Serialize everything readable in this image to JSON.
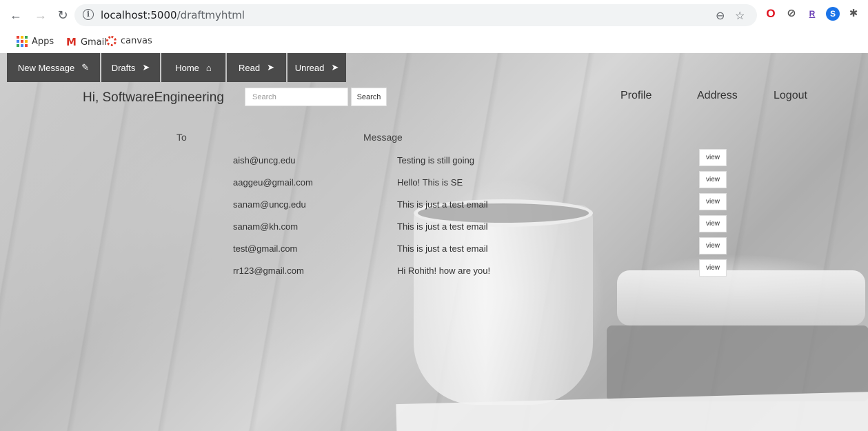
{
  "browser": {
    "url_host": "localhost:5000",
    "url_path": "/draftmyhtml",
    "bookmarks": [
      {
        "label": "Apps"
      },
      {
        "label": "Gmail"
      },
      {
        "label": "canvas"
      }
    ]
  },
  "nav": [
    {
      "label": "New Message",
      "icon": "pencil-icon"
    },
    {
      "label": "Drafts",
      "icon": "send-icon"
    },
    {
      "label": "Home",
      "icon": "home-icon"
    },
    {
      "label": "Read",
      "icon": "send-icon"
    },
    {
      "label": "Unread",
      "icon": "send-icon"
    }
  ],
  "header": {
    "greeting": "Hi, SoftwareEngineering",
    "search_placeholder": "Search",
    "search_button": "Search",
    "links": [
      "Profile",
      "Address",
      "Logout"
    ]
  },
  "table": {
    "columns": [
      "To",
      "Message"
    ],
    "rows": [
      {
        "to": "aish@uncg.edu",
        "message": "Testing is still going",
        "action": "view"
      },
      {
        "to": "aaggeu@gmail.com",
        "message": "Hello! This is SE",
        "action": "view"
      },
      {
        "to": "sanam@uncg.edu",
        "message": "This is just a test email",
        "action": "view"
      },
      {
        "to": "sanam@kh.com",
        "message": "This is just a test email",
        "action": "view"
      },
      {
        "to": "test@gmail.com",
        "message": "This is just a test email",
        "action": "view"
      },
      {
        "to": "rr123@gmail.com",
        "message": "Hi Rohith! how are you!",
        "action": "view"
      }
    ]
  }
}
